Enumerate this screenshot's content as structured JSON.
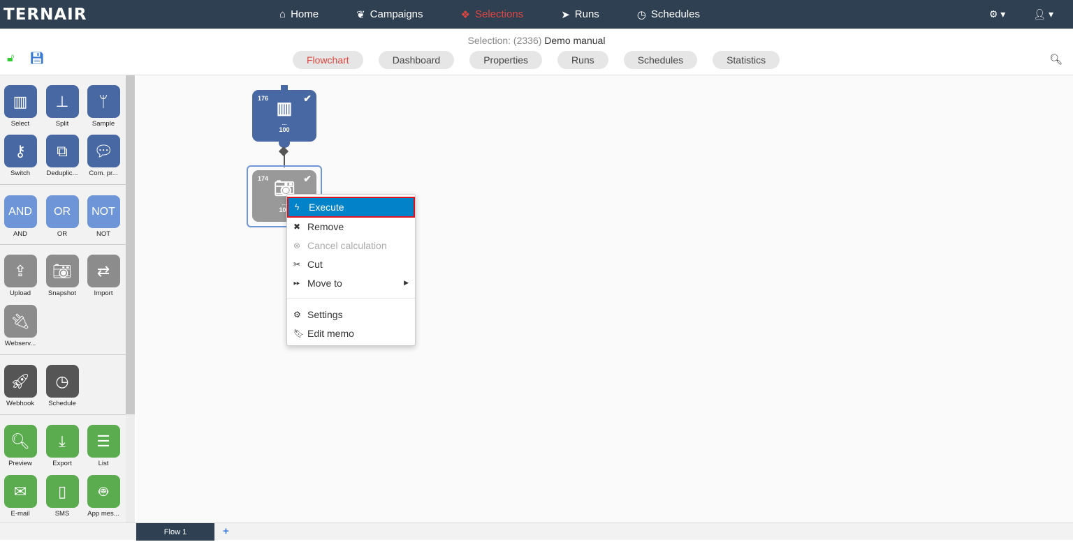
{
  "app": {
    "logo": "TERNAIR"
  },
  "nav": [
    {
      "label": "Home",
      "icon": "home-icon"
    },
    {
      "label": "Campaigns",
      "icon": "leaf-icon"
    },
    {
      "label": "Selections",
      "icon": "cubes-icon",
      "active": true
    },
    {
      "label": "Runs",
      "icon": "paper-plane-icon"
    },
    {
      "label": "Schedules",
      "icon": "clock-icon"
    }
  ],
  "header": {
    "prefix": "Selection: (2336)",
    "name": "Demo manual"
  },
  "tabs": [
    "Flowchart",
    "Dashboard",
    "Properties",
    "Runs",
    "Schedules",
    "Statistics"
  ],
  "tools": {
    "select": "Select",
    "split": "Split",
    "sample": "Sample",
    "switch": "Switch",
    "dedup": "Deduplic...",
    "compr": "Com. pr...",
    "and": "AND",
    "or": "OR",
    "not": "NOT",
    "upload": "Upload",
    "snapshot": "Snapshot",
    "import": "Import",
    "webserv": "Webserv...",
    "webhook": "Webhook",
    "schedule": "Schedule",
    "preview": "Preview",
    "export": "Export",
    "list": "List",
    "email": "E-mail",
    "sms": "SMS",
    "appmes": "App mes..."
  },
  "nodes": [
    {
      "id": "176",
      "count": "100",
      "dots": "...."
    },
    {
      "id": "174",
      "count": "100",
      "dots": "...."
    }
  ],
  "menu": {
    "execute": "Execute",
    "remove": "Remove",
    "cancel": "Cancel calculation",
    "cut": "Cut",
    "move": "Move to",
    "settings": "Settings",
    "memo": "Edit memo"
  },
  "flowtabs": {
    "flow1": "Flow 1",
    "add": "+"
  }
}
